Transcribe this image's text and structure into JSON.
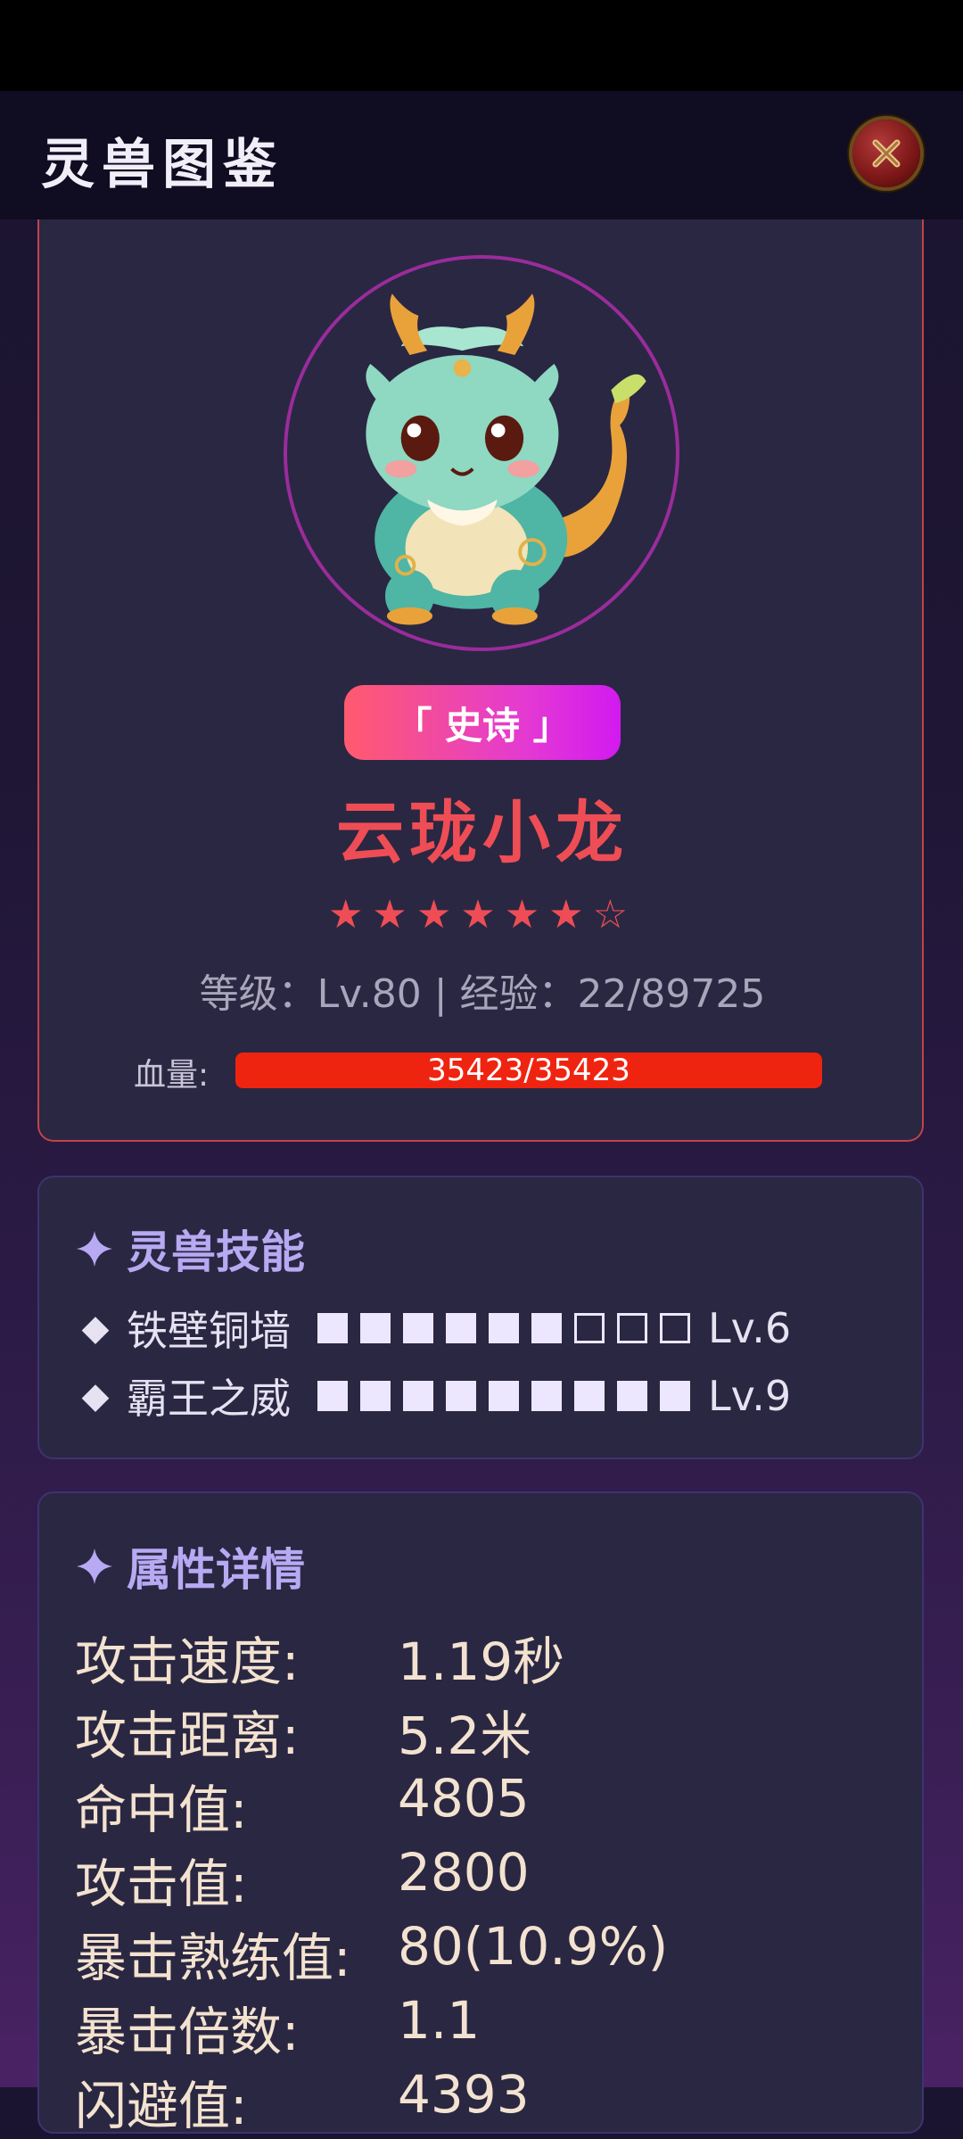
{
  "header": {
    "title": "灵兽图鉴",
    "close_icon": "close-x-icon"
  },
  "profile": {
    "rarity": "「 史诗 」",
    "name": "云珑小龙",
    "stars": "★★★★★★☆",
    "stars_filled": 6,
    "stars_total": 7,
    "level_line": "等级：Lv.80 | 经验：22/89725",
    "hp_label": "血量:",
    "hp_text": "35423/35423",
    "hp_fraction": 1.0
  },
  "skills": {
    "title": "灵兽技能",
    "items": [
      {
        "name": "铁壁铜墙",
        "pips_filled": 6,
        "pips_total": 9,
        "level": "Lv.6"
      },
      {
        "name": "霸王之威",
        "pips_filled": 9,
        "pips_total": 9,
        "level": "Lv.9"
      }
    ]
  },
  "attributes": {
    "title": "属性详情",
    "items": [
      {
        "label": "攻击速度:",
        "value": "1.19秒"
      },
      {
        "label": "攻击距离:",
        "value": "5.2米"
      },
      {
        "label": "命中值:",
        "value": "4805"
      },
      {
        "label": "攻击值:",
        "value": "2800"
      },
      {
        "label": "暴击熟练值:",
        "value": "80(10.9%)"
      },
      {
        "label": "暴击倍数:",
        "value": "1.1"
      },
      {
        "label": "闪避值:",
        "value": "4393"
      }
    ]
  },
  "colors": {
    "accent_red": "#ef4d55",
    "section_purple": "#b7a9f2",
    "hp_fill": "#ef2410"
  }
}
